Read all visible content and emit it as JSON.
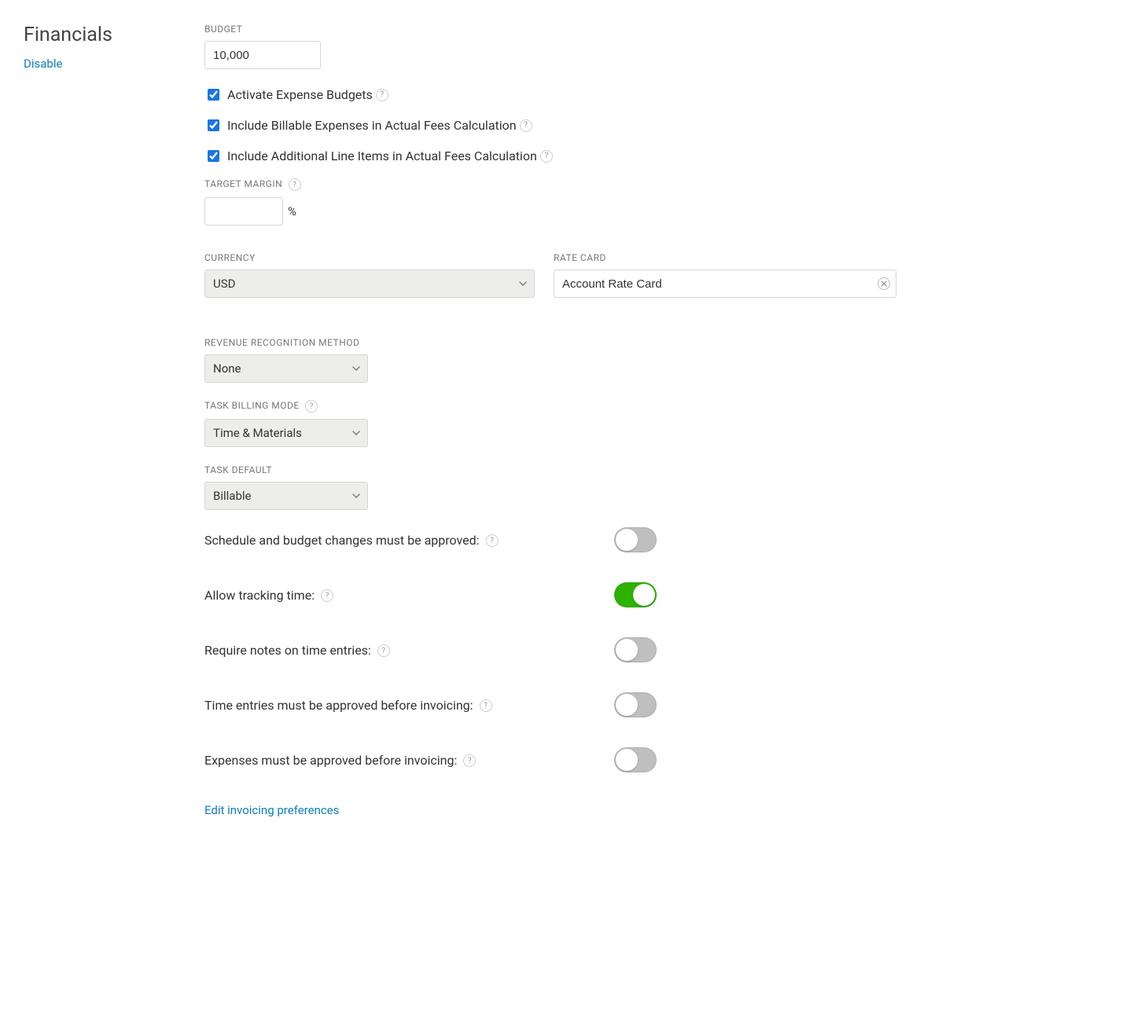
{
  "section": {
    "title": "Financials",
    "disable_label": "Disable"
  },
  "budget": {
    "label": "BUDGET",
    "value": "10,000"
  },
  "checkboxes": {
    "activate_expense_budgets": {
      "label": "Activate Expense Budgets",
      "checked": true
    },
    "include_billable_expenses": {
      "label": "Include Billable Expenses in Actual Fees Calculation",
      "checked": true
    },
    "include_line_items": {
      "label": "Include Additional Line Items in Actual Fees Calculation",
      "checked": true
    }
  },
  "target_margin": {
    "label": "TARGET MARGIN",
    "value": "",
    "suffix": "%"
  },
  "currency": {
    "label": "CURRENCY",
    "value": "USD"
  },
  "rate_card": {
    "label": "RATE CARD",
    "value": "Account Rate Card"
  },
  "revenue_method": {
    "label": "REVENUE RECOGNITION METHOD",
    "value": "None"
  },
  "task_billing_mode": {
    "label": "TASK BILLING MODE",
    "value": "Time & Materials"
  },
  "task_default": {
    "label": "TASK DEFAULT",
    "value": "Billable"
  },
  "toggles": {
    "schedule_budget_approval": {
      "label": "Schedule and budget changes must be approved:",
      "on": false
    },
    "allow_tracking_time": {
      "label": "Allow tracking time:",
      "on": true
    },
    "require_notes_time": {
      "label": "Require notes on time entries:",
      "on": false
    },
    "time_entries_approved": {
      "label": "Time entries must be approved before invoicing:",
      "on": false
    },
    "expenses_approved": {
      "label": "Expenses must be approved before invoicing:",
      "on": false
    }
  },
  "edit_invoicing_link": "Edit invoicing preferences",
  "help_glyph": "?"
}
